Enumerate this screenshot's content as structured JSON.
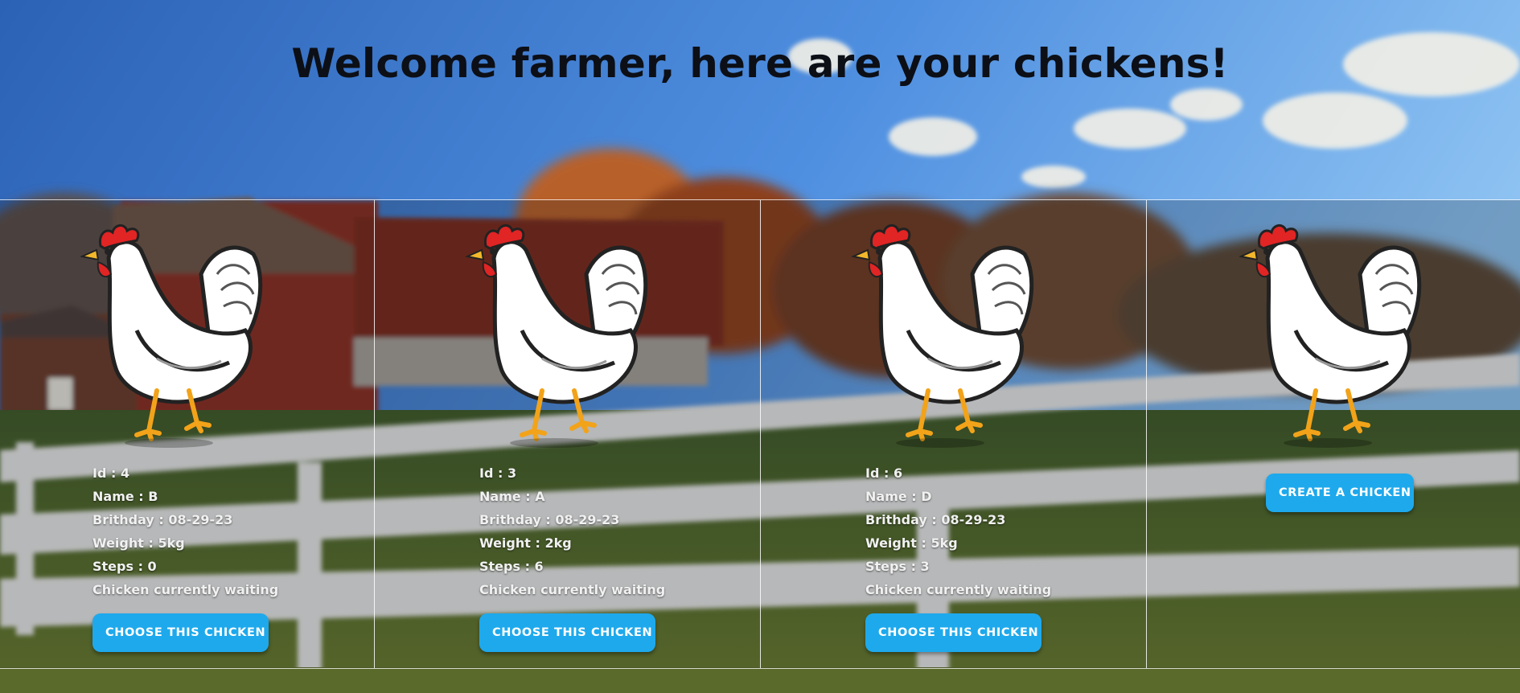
{
  "page": {
    "title": "Welcome farmer, here are your chickens!"
  },
  "chickens": [
    {
      "id": "Id : 4",
      "name": "Name : B",
      "birthday": "Brithday : 08-29-23",
      "weight": "Weight : 5kg",
      "steps": "Steps : 0",
      "status": "Chicken currently waiting",
      "button_label": "CHOOSE THIS CHICKEN"
    },
    {
      "id": "Id : 3",
      "name": "Name : A",
      "birthday": "Brithday : 08-29-23",
      "weight": "Weight : 2kg",
      "steps": "Steps : 6",
      "status": "Chicken currently waiting",
      "button_label": "CHOOSE THIS CHICKEN"
    },
    {
      "id": "Id : 6",
      "name": "Name : D",
      "birthday": "Brithday : 08-29-23",
      "weight": "Weight : 5kg",
      "steps": "Steps : 3",
      "status": "Chicken currently waiting",
      "button_label": "CHOOSE THIS CHICKEN"
    }
  ],
  "create_card": {
    "button_label": "CREATE A CHICKEN"
  },
  "colors": {
    "button": "#1ea9ec",
    "button_text": "#ffffff",
    "title_text": "#0c0f16",
    "info_text": "#f1f1f1"
  },
  "icons": {
    "chicken": "white-hen-icon"
  }
}
